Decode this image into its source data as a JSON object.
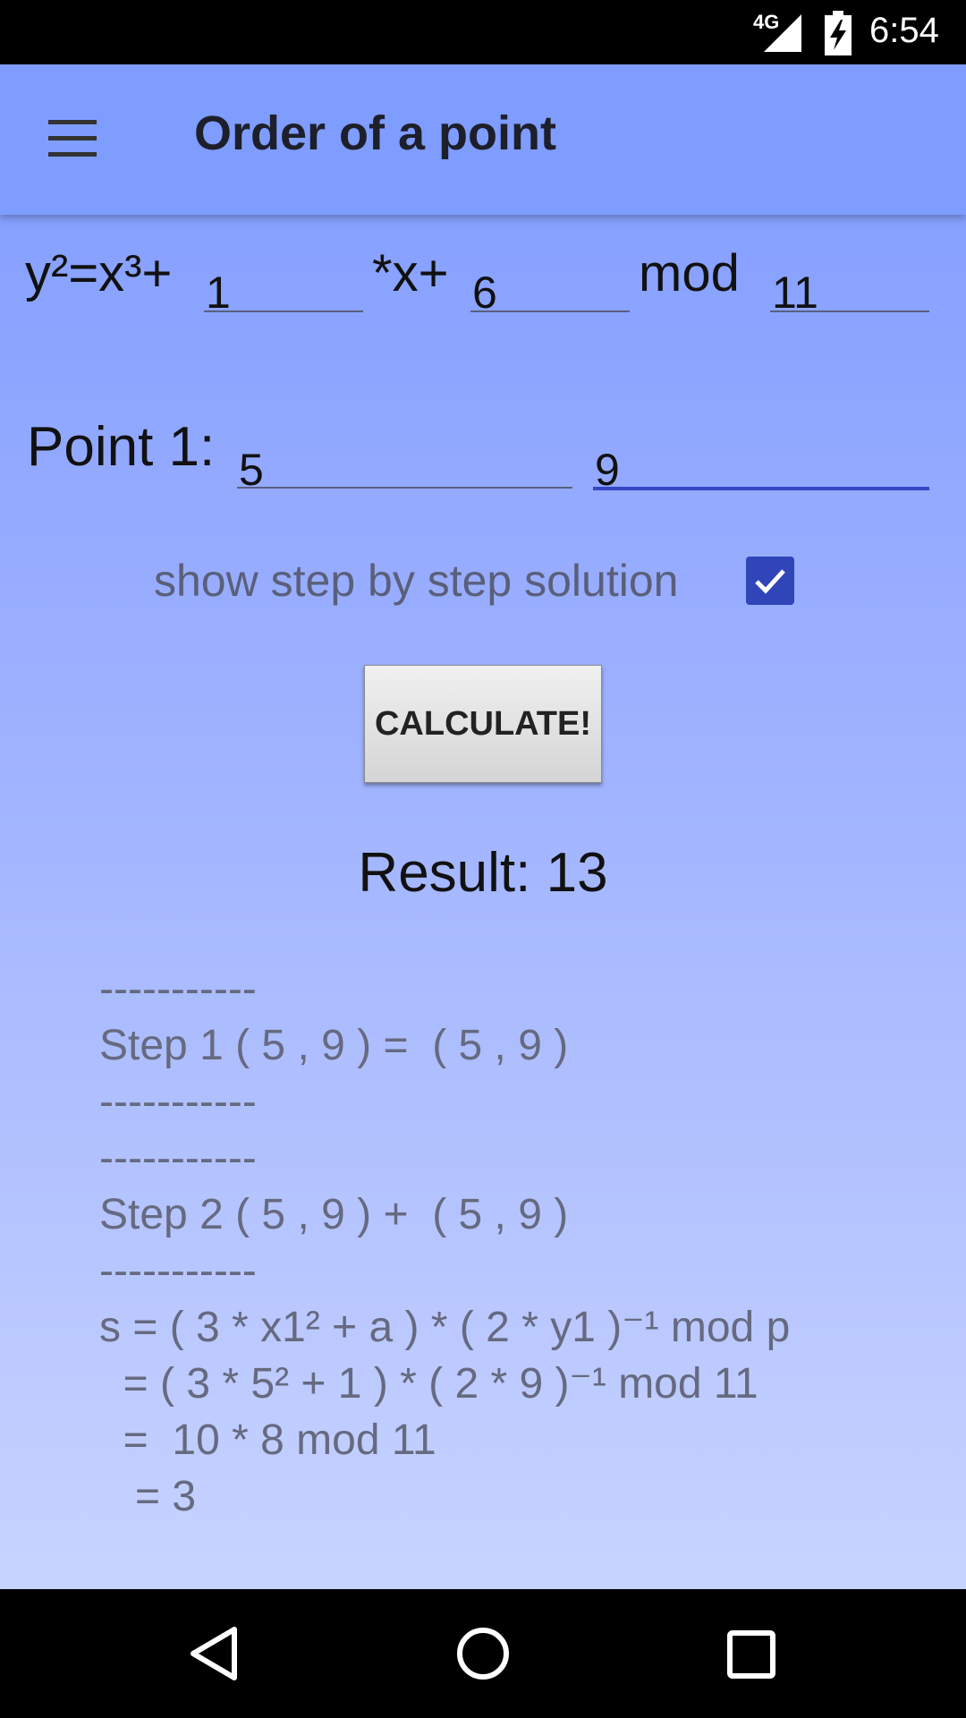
{
  "status_bar": {
    "network": "4G",
    "time": "6:54"
  },
  "toolbar": {
    "title": "Order of a point",
    "menu_icon": "hamburger-menu-icon"
  },
  "equation": {
    "prefix": "y²=x³+",
    "a_value": "1",
    "mul": "*x+",
    "b_value": "6",
    "mod_label": "mod",
    "p_value": "11"
  },
  "point": {
    "label": "Point 1:",
    "x_value": "5",
    "y_value": "9"
  },
  "options": {
    "step_label": "show step by step solution",
    "checked": true
  },
  "button": {
    "label": "CALCULATE!"
  },
  "result": {
    "text": "Result: 13"
  },
  "steps": [
    "-----------",
    "Step 1 ( 5 , 9 ) =  ( 5 , 9 )",
    "-----------",
    "-----------",
    "Step 2 ( 5 , 9 ) +  ( 5 , 9 )",
    "-----------",
    "s = ( 3 * x1² + a ) * ( 2 * y1 )⁻¹ mod p",
    "  = ( 3 * 5² + 1 ) * ( 2 * 9 )⁻¹ mod 11",
    "  =  10 * 8 mod 11",
    "   = 3"
  ]
}
